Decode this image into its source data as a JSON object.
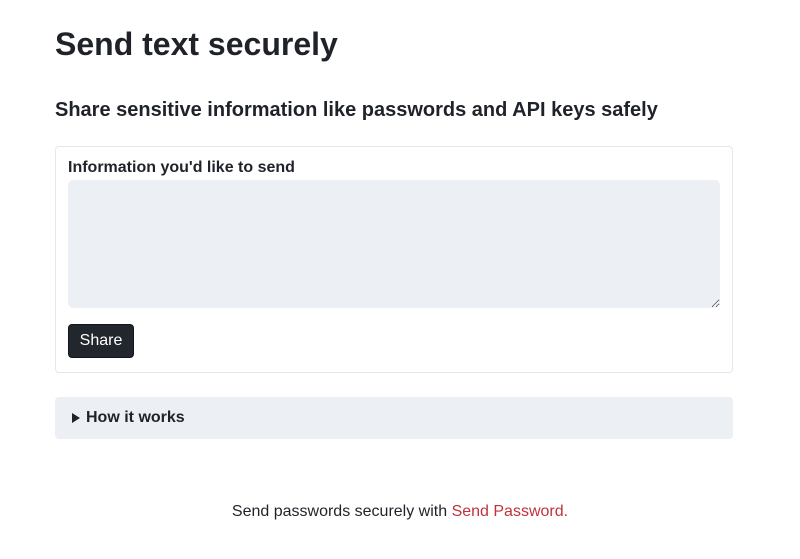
{
  "header": {
    "title": "Send text securely",
    "subtitle": "Share sensitive information like passwords and API keys safely"
  },
  "form": {
    "label": "Information you'd like to send",
    "textarea_value": "",
    "textarea_placeholder": "",
    "share_label": "Share"
  },
  "details": {
    "label": "How it works",
    "icon": "triangle-right-icon"
  },
  "footer": {
    "text": "Send passwords securely with ",
    "link_text": "Send Password."
  },
  "colors": {
    "link": "#c0323c",
    "button_bg": "#22262d",
    "panel_bg": "#eceff3"
  }
}
